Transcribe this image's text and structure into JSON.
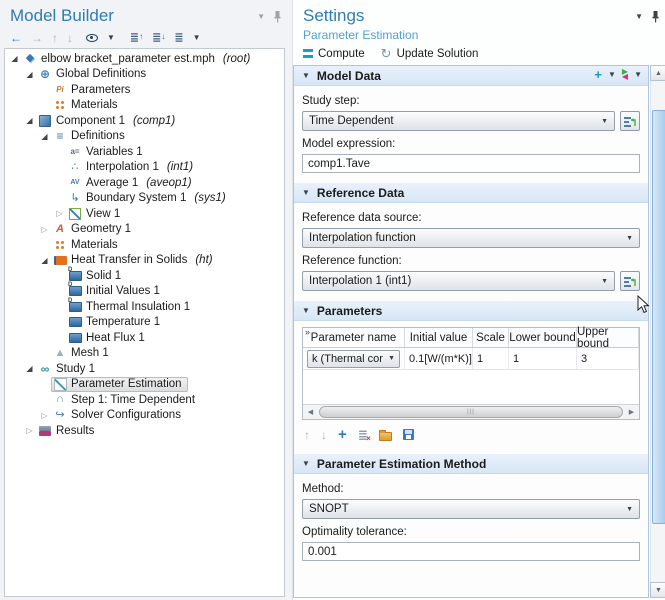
{
  "model_builder": {
    "title": "Model Builder",
    "tree": [
      {
        "level": 0,
        "expander": "open",
        "icon": "model-root-icon",
        "label": "elbow bracket_parameter est.mph",
        "suffix": "(root)"
      },
      {
        "level": 1,
        "expander": "open",
        "icon": "global-definitions-icon",
        "label": "Global Definitions"
      },
      {
        "level": 2,
        "expander": "none",
        "icon": "parameters-icon",
        "label": "Parameters"
      },
      {
        "level": 2,
        "expander": "none",
        "icon": "materials-icon",
        "label": "Materials"
      },
      {
        "level": 1,
        "expander": "open",
        "icon": "component-icon",
        "label": "Component 1",
        "suffix": "(comp1)"
      },
      {
        "level": 2,
        "expander": "open",
        "icon": "definitions-icon",
        "label": "Definitions"
      },
      {
        "level": 3,
        "expander": "none",
        "icon": "variables-icon",
        "label": "Variables 1"
      },
      {
        "level": 3,
        "expander": "none",
        "icon": "interpolation-icon",
        "label": "Interpolation 1",
        "suffix": "(int1)"
      },
      {
        "level": 3,
        "expander": "none",
        "icon": "average-icon",
        "label": "Average 1",
        "suffix": "(aveop1)"
      },
      {
        "level": 3,
        "expander": "none",
        "icon": "boundary-system-icon",
        "label": "Boundary System 1",
        "suffix": "(sys1)"
      },
      {
        "level": 3,
        "expander": "collapsed",
        "icon": "view-icon",
        "label": "View 1"
      },
      {
        "level": 2,
        "expander": "collapsed",
        "icon": "geometry-icon",
        "label": "Geometry 1"
      },
      {
        "level": 2,
        "expander": "none",
        "icon": "materials-icon",
        "label": "Materials"
      },
      {
        "level": 2,
        "expander": "open",
        "icon": "heat-transfer-icon",
        "label": "Heat Transfer in Solids",
        "suffix": "(ht)"
      },
      {
        "level": 3,
        "expander": "none",
        "icon": "physics-default-feature-icon",
        "label": "Solid 1"
      },
      {
        "level": 3,
        "expander": "none",
        "icon": "physics-default-feature-icon",
        "label": "Initial Values 1"
      },
      {
        "level": 3,
        "expander": "none",
        "icon": "physics-default-feature-icon",
        "label": "Thermal Insulation 1"
      },
      {
        "level": 3,
        "expander": "none",
        "icon": "physics-feature-icon",
        "label": "Temperature 1"
      },
      {
        "level": 3,
        "expander": "none",
        "icon": "physics-feature-icon",
        "label": "Heat Flux 1"
      },
      {
        "level": 2,
        "expander": "none",
        "icon": "mesh-icon",
        "label": "Mesh 1"
      },
      {
        "level": 1,
        "expander": "open",
        "icon": "study-icon",
        "label": "Study 1"
      },
      {
        "level": 2,
        "expander": "none",
        "icon": "parameter-estimation-icon",
        "label": "Parameter Estimation",
        "selected": true
      },
      {
        "level": 2,
        "expander": "none",
        "icon": "time-dependent-icon",
        "label": "Step 1: Time Dependent"
      },
      {
        "level": 2,
        "expander": "collapsed",
        "icon": "solver-configurations-icon",
        "label": "Solver Configurations"
      },
      {
        "level": 1,
        "expander": "collapsed",
        "icon": "results-icon",
        "label": "Results"
      }
    ]
  },
  "icons": {
    "model-root-icon": {
      "glyph": "◆",
      "color": "#3d76b4"
    },
    "global-definitions-icon": {
      "glyph": "⊕",
      "color": "#3c7ec0"
    },
    "parameters-icon": {
      "glyph": "Pi",
      "color": "#c0762a"
    },
    "materials-icon": {
      "glyph": "",
      "color": ""
    },
    "component-icon": {
      "glyph": "",
      "color": ""
    },
    "definitions-icon": {
      "glyph": "≡",
      "color": "#4a7ba6"
    },
    "variables-icon": {
      "glyph": "a=",
      "color": "#5f6c7a"
    },
    "interpolation-icon": {
      "glyph": "∴",
      "color": "#3d7ab8"
    },
    "average-icon": {
      "glyph": "AV",
      "color": "#3d7ab8"
    },
    "boundary-system-icon": {
      "glyph": "↳",
      "color": "#3d7ab8"
    },
    "view-icon": {
      "glyph": "",
      "color": ""
    },
    "geometry-icon": {
      "glyph": "A",
      "color": "#cd5a45"
    },
    "heat-transfer-icon": {
      "glyph": "",
      "color": ""
    },
    "physics-feature-icon": {
      "glyph": "",
      "color": ""
    },
    "physics-default-feature-icon": {
      "glyph": "",
      "color": ""
    },
    "mesh-icon": {
      "glyph": "▲",
      "color": "#9fb0bc"
    },
    "study-icon": {
      "glyph": "∞",
      "color": "#2f8e9e"
    },
    "parameter-estimation-icon": {
      "glyph": "",
      "color": ""
    },
    "time-dependent-icon": {
      "glyph": "∩",
      "color": "#4f8fc0"
    },
    "solver-configurations-icon": {
      "glyph": "↪",
      "color": "#3d7ab8"
    },
    "results-icon": {
      "glyph": "",
      "color": ""
    }
  },
  "settings": {
    "title": "Settings",
    "subtitle": "Parameter Estimation",
    "toolbar": {
      "compute_label": "Compute",
      "update_solution_label": "Update Solution"
    },
    "sections": {
      "model_data": {
        "title": "Model Data",
        "study_step_label": "Study step:",
        "study_step_value": "Time Dependent",
        "model_expression_label": "Model expression:",
        "model_expression_value": "comp1.Tave"
      },
      "reference_data": {
        "title": "Reference Data",
        "source_label": "Reference data source:",
        "source_value": "Interpolation function",
        "function_label": "Reference function:",
        "function_value": "Interpolation 1 (int1)"
      },
      "parameters": {
        "title": "Parameters",
        "table": {
          "corner": "»",
          "headers": [
            "Parameter name",
            "Initial value",
            "Scale",
            "Lower bound",
            "Upper bound"
          ],
          "rows": [
            {
              "parameter_name": "k (Thermal cor",
              "initial_value": "0.1[W/(m*K)]",
              "scale": "1",
              "lower_bound": "1",
              "upper_bound": "3"
            }
          ]
        }
      },
      "method": {
        "title": "Parameter Estimation Method",
        "method_label": "Method:",
        "method_value": "SNOPT",
        "tolerance_label": "Optimality tolerance:",
        "tolerance_value": "0.001"
      }
    },
    "colors": {
      "accent_blue": "#2e7db3",
      "subtitle_blue": "#52a1d8",
      "section_bar": "#d7e6f6"
    }
  }
}
